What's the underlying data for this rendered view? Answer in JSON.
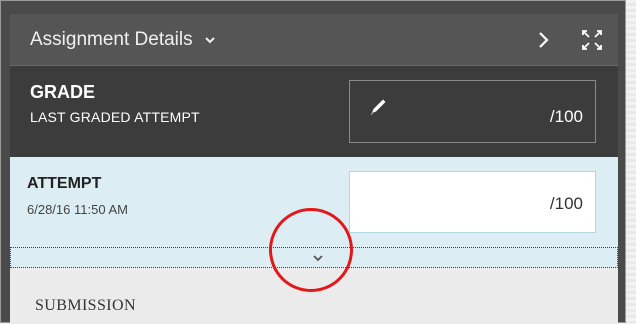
{
  "header": {
    "title": "Assignment Details",
    "caret_icon": "chevron-down-icon",
    "next_icon": "chevron-right-icon",
    "expand_icon": "fullscreen-icon"
  },
  "grade": {
    "title": "GRADE",
    "subtitle": "LAST GRADED ATTEMPT",
    "value": "/100",
    "edit_icon": "pencil-icon"
  },
  "attempt": {
    "title": "ATTEMPT",
    "date": "6/28/16 11:50 AM",
    "value": "/100"
  },
  "expand": {
    "icon": "chevron-down-icon"
  },
  "submission": {
    "label": "SUBMISSION"
  },
  "colors": {
    "header_bg": "#555555",
    "grade_bg": "#3c3c3c",
    "attempt_bg": "#dcedf3",
    "annotation": "#e31818"
  }
}
